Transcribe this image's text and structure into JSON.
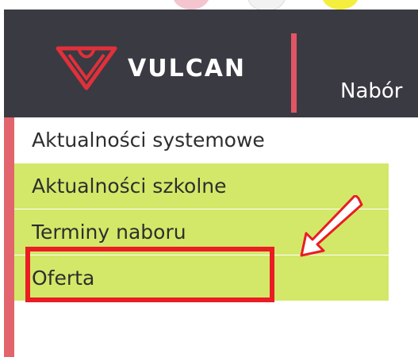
{
  "header": {
    "brand": "VULCAN",
    "nav_label": "Nabór"
  },
  "menu": {
    "items": [
      {
        "label": "Aktualności systemowe"
      },
      {
        "label": "Aktualności szkolne"
      },
      {
        "label": "Terminy naboru"
      },
      {
        "label": "Oferta"
      }
    ]
  },
  "colors": {
    "header_bg": "#3a3a42",
    "accent_red": "#e25564",
    "menu_green": "#d3e868",
    "highlight_red": "#ea1c24"
  },
  "icons": [
    "vulcan-logo-icon",
    "arrow-pointer-icon"
  ]
}
